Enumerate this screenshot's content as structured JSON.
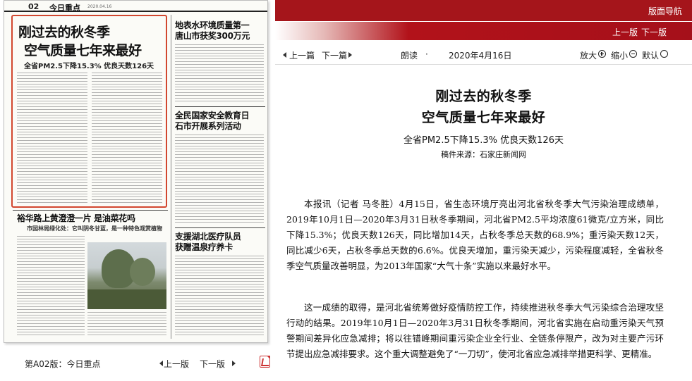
{
  "newspaper": {
    "page_number": "02",
    "section": "今日重点",
    "header_small": "2020.04.16",
    "lead_headline_line1": "刚过去的秋冬季",
    "lead_headline_line2": "空气质量七年来最好",
    "lead_subhead": "全省PM2.5下降15.3% 优良天数126天",
    "side_story1": "地表水环境质量第一",
    "side_story1_line2": "唐山市获奖300万元",
    "side_story2_line1": "全民国家安全教育日",
    "side_story2_line2": "石市开展系列活动",
    "side_story3_line1": "支援湖北医疗队员",
    "side_story3_line2": "获赠温泉疗养卡",
    "lower_headline": "裕华路上黄澄澄一片  是油菜花吗",
    "lower_subhead": "市园林局绿化处：它叫阴冬甘蓝，是一种特色观赏植物"
  },
  "footer": {
    "edition_label": "第A02版：今日重点",
    "prev_label": "上一版",
    "next_label": "下一版",
    "pdf_icon": "pdf-icon"
  },
  "nav": {
    "title": "版面导航",
    "prev_edition": "上一版",
    "next_edition": "下一版"
  },
  "toolbar": {
    "prev_article": "上一篇",
    "next_article": "下一篇",
    "read_aloud": "朗读",
    "separator": "·",
    "date": "2020年4月16日",
    "zoom_in": "放大",
    "zoom_out": "缩小",
    "default": "默认"
  },
  "article": {
    "title_line1": "刚过去的秋冬季",
    "title_line2": "空气质量七年来最好",
    "subtitle": "全省PM2.5下降15.3% 优良天数126天",
    "source": "稿件来源：石家庄新闻网",
    "paragraphs": [
      "本报讯（记者 马冬胜）4月15日，省生态环境厅亮出河北省秋冬季大气污染治理成绩单，2019年10月1日—2020年3月31日秋冬季期间，河北省PM2.5平均浓度61微克/立方米，同比下降15.3%；优良天数126天，同比增加14天，占秋冬季总天数的68.9%；重污染天数12天，同比减少6天，占秋冬季总天数的6.6%。优良天增加，重污染天减少，污染程度减轻，全省秋冬季空气质量改善明显，为2013年国家“大气十条”实施以来最好水平。",
      "这一成绩的取得，是河北省统筹做好疫情防控工作，持续推进秋冬季大气污染综合治理攻坚行动的结果。2019年10月1日—2020年3月31日秋冬季期间，河北省实施在启动重污染天气预警期间差异化应急减排；将以往错峰期间重污染企业全行业、全链条停限产，改为对主要产污环节提出应急减排要求。这个重大调整避免了“一刀切”，使河北省应急减排举措更科学、更精准。"
    ]
  },
  "colors": {
    "nav_red": "#a5151b",
    "highlight_box": "#d2472f"
  }
}
